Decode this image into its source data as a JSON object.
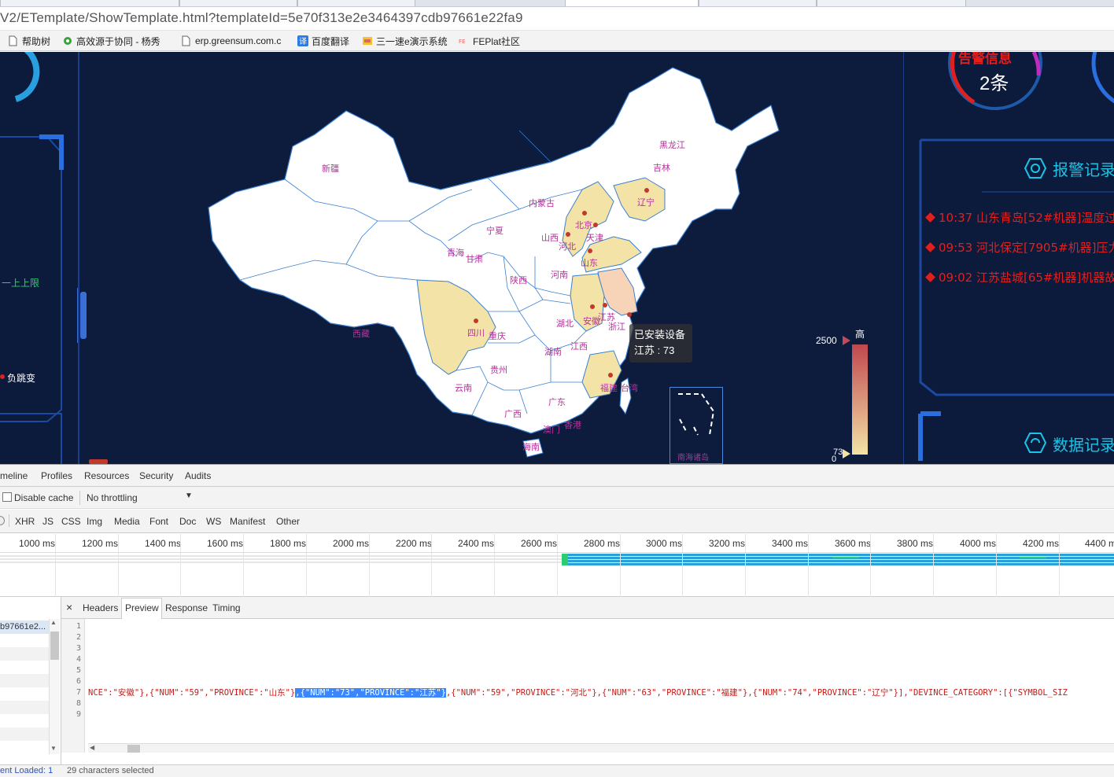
{
  "browser": {
    "url": "V2/ETemplate/ShowTemplate.html?templateId=5e70f313e2e3464397cdb97661e22fa9",
    "bookmarks": [
      {
        "label": "帮助树",
        "icon": "page-icon"
      },
      {
        "label": "高效源于协同 - 杨秀",
        "icon": "gear-icon"
      },
      {
        "label": "erp.greensum.com.c",
        "icon": "page-icon"
      },
      {
        "label": "百度翻译",
        "icon": "translate-icon"
      },
      {
        "label": "三一速e演示系统",
        "icon": "app-icon"
      },
      {
        "label": "FEPlat社区",
        "icon": "fe-icon"
      }
    ]
  },
  "dashboard": {
    "warning_title": "告警信息",
    "warning_count": "2条",
    "left_label_limit": "一上上限",
    "left_label_jump": "负跳变",
    "alarm_section_title": "报警记录",
    "data_section_title": "数据记录",
    "alarms": [
      "10:37 山东青岛[52#机器]温度过",
      "09:53 河北保定[7905#机器]压力",
      "09:02 江苏盐城[65#机器]机器故"
    ],
    "tooltip": {
      "title": "已安装设备",
      "line": "江苏 : 73"
    },
    "legend": {
      "high_label": "高",
      "max": "2500",
      "min": "73",
      "zero": "0"
    },
    "south_sea_label": "南海诸岛",
    "provinces": [
      {
        "name": "新疆"
      },
      {
        "name": "西藏"
      },
      {
        "name": "青海"
      },
      {
        "name": "甘肃"
      },
      {
        "name": "内蒙古"
      },
      {
        "name": "宁夏"
      },
      {
        "name": "黑龙江"
      },
      {
        "name": "吉林"
      },
      {
        "name": "辽宁"
      },
      {
        "name": "北京"
      },
      {
        "name": "天津"
      },
      {
        "name": "河北"
      },
      {
        "name": "山西"
      },
      {
        "name": "山东"
      },
      {
        "name": "河南"
      },
      {
        "name": "陕西"
      },
      {
        "name": "四川"
      },
      {
        "name": "重庆"
      },
      {
        "name": "湖北"
      },
      {
        "name": "安徽"
      },
      {
        "name": "江苏"
      },
      {
        "name": "浙江"
      },
      {
        "name": "湖南"
      },
      {
        "name": "江西"
      },
      {
        "name": "贵州"
      },
      {
        "name": "云南"
      },
      {
        "name": "广西"
      },
      {
        "name": "广东"
      },
      {
        "name": "福建"
      },
      {
        "name": "台湾"
      },
      {
        "name": "澳门"
      },
      {
        "name": "香港"
      },
      {
        "name": "海南"
      }
    ]
  },
  "devtools": {
    "main_tabs": [
      "meline",
      "Profiles",
      "Resources",
      "Security",
      "Audits"
    ],
    "disable_cache_label": "Disable cache",
    "throttling_value": "No throttling",
    "filters": [
      "XHR",
      "JS",
      "CSS",
      "Img",
      "Media",
      "Font",
      "Doc",
      "WS",
      "Manifest",
      "Other"
    ],
    "ticks": [
      "1000 ms",
      "1200 ms",
      "1400 ms",
      "1600 ms",
      "1800 ms",
      "2000 ms",
      "2200 ms",
      "2400 ms",
      "2600 ms",
      "2800 ms",
      "3000 ms",
      "3200 ms",
      "3400 ms",
      "3600 ms",
      "3800 ms",
      "4000 ms",
      "4200 ms",
      "4400 m"
    ],
    "request_name": "b97661e2...",
    "detail_tabs": [
      "Headers",
      "Preview",
      "Response",
      "Timing"
    ],
    "close_glyph": "×",
    "line_numbers": [
      "1",
      "2",
      "3",
      "4",
      "5",
      "6",
      "7",
      "8",
      "9"
    ],
    "code_prefix": "NCE\":\"安徽\"},{\"NUM\":\"59\",\"PROVINCE\":\"山东\"}",
    "code_selected": ",{\"NUM\":\"73\",\"PROVINCE\":\"江苏\"}",
    "code_suffix": ",{\"NUM\":\"59\",\"PROVINCE\":\"河北\"},{\"NUM\":\"63\",\"PROVINCE\":\"福建\"},{\"NUM\":\"74\",\"PROVINCE\":\"辽宁\"}],\"DEVINCE_CATEGORY\":[{\"SYMBOL_SIZ",
    "status_left": "ent Loaded: 1",
    "status_right": "29 characters selected"
  },
  "colors": {
    "dash_bg": "#0d1b3d",
    "map_fill": "#ffffff",
    "map_highlight": "#f3e3a6",
    "map_selected": "#f7d4b8",
    "map_border": "#3a7fd0",
    "province_label": "#b5339a",
    "alarm_red": "#e0201f",
    "accent_cyan": "#19c4e6",
    "selection_blue": "#3a86ff"
  }
}
